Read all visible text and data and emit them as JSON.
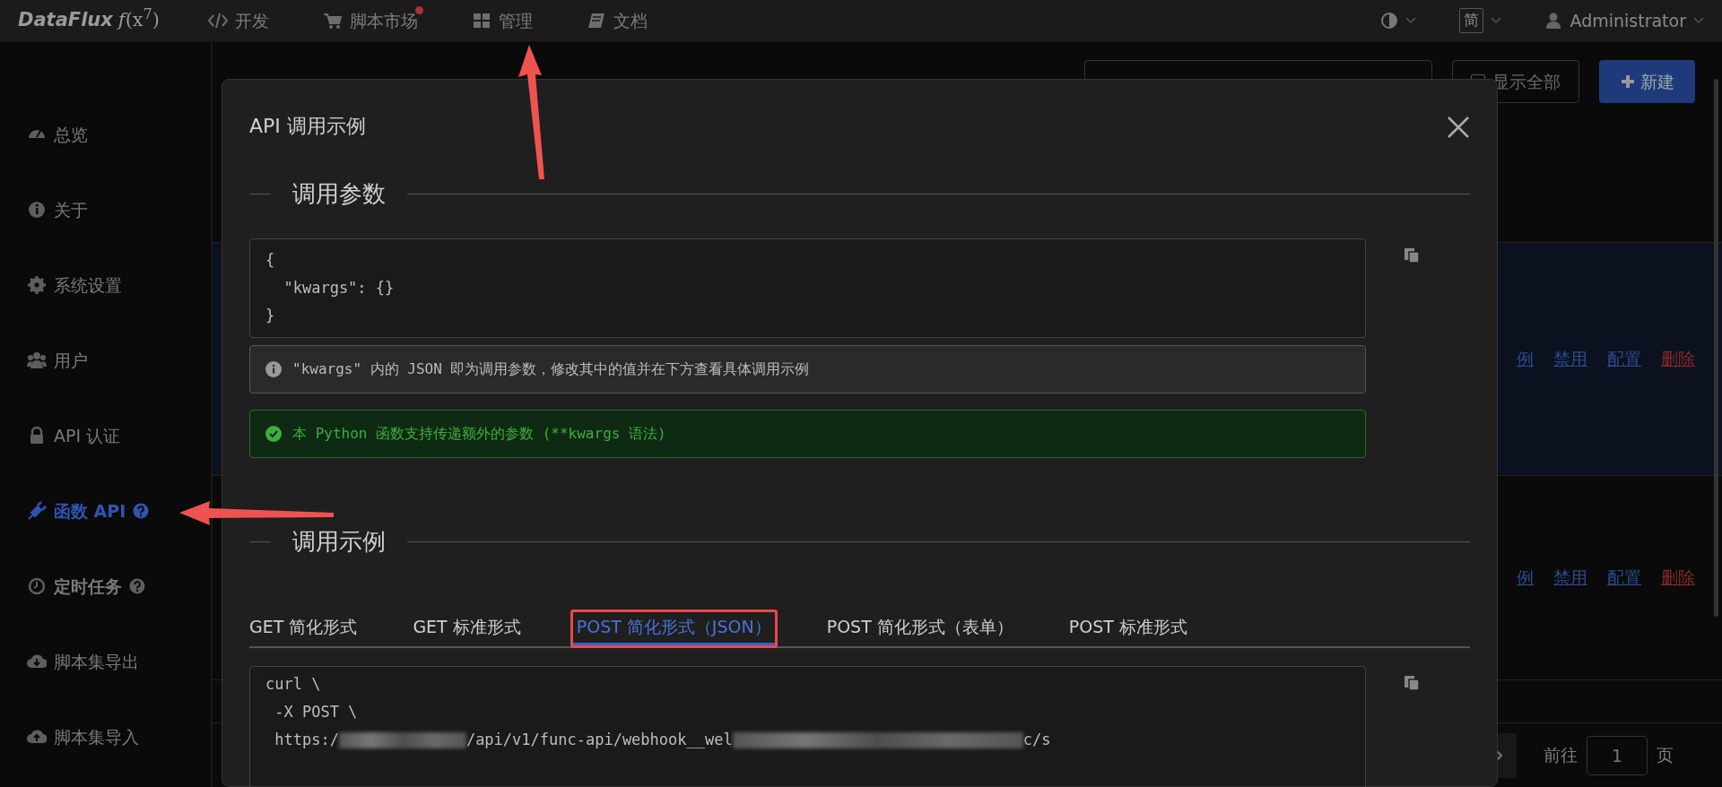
{
  "topbar": {
    "logo": "DataFlux",
    "logo_mark": "*f*(x$^{7}$)",
    "nav": [
      {
        "label": "开发",
        "kind": "code",
        "notification": false
      },
      {
        "label": "脚本市场",
        "kind": "cart",
        "notification": true
      },
      {
        "label": "管理",
        "kind": "grid",
        "notification": false
      },
      {
        "label": "文档",
        "kind": "book",
        "notification": false
      }
    ],
    "language": "简",
    "user": "Administrator"
  },
  "sidebar": {
    "items": [
      {
        "label": "总览",
        "kind": "gauge",
        "selected": false,
        "bold": false,
        "help": false
      },
      {
        "label": "关于",
        "kind": "info",
        "selected": false,
        "bold": false,
        "help": false
      },
      {
        "label": "系统设置",
        "kind": "gear",
        "selected": false,
        "bold": false,
        "help": false
      },
      {
        "label": "用户",
        "kind": "users",
        "selected": false,
        "bold": false,
        "help": false
      },
      {
        "label": "API 认证",
        "kind": "lock",
        "selected": false,
        "bold": false,
        "help": false
      },
      {
        "label": "函数 API",
        "kind": "plug",
        "selected": true,
        "bold": true,
        "help": true
      },
      {
        "label": "定时任务",
        "kind": "clock",
        "selected": false,
        "bold": true,
        "help": true
      },
      {
        "label": "脚本集导出",
        "kind": "cloud-down",
        "selected": false,
        "bold": false,
        "help": false
      },
      {
        "label": "脚本集导入",
        "kind": "cloud-up",
        "selected": false,
        "bold": false,
        "help": false
      }
    ]
  },
  "page": {
    "show_all": {
      "label": "显示全部",
      "checked": false
    },
    "new_button": "新建",
    "rows": [
      {
        "highlighted": true,
        "actions": [
          {
            "label": "例",
            "kind": "link"
          },
          {
            "label": "禁用",
            "kind": "link"
          },
          {
            "label": "配置",
            "kind": "link"
          },
          {
            "label": "删除",
            "kind": "danger"
          }
        ]
      },
      {
        "highlighted": false,
        "actions": [
          {
            "label": "例",
            "kind": "link"
          },
          {
            "label": "禁用",
            "kind": "link"
          },
          {
            "label": "配置",
            "kind": "link"
          },
          {
            "label": "删除",
            "kind": "danger"
          }
        ]
      }
    ],
    "pagination": {
      "goto": "前往",
      "page": "1",
      "suffix": "页"
    }
  },
  "dialog": {
    "title": "API 调用示例",
    "params": {
      "heading": "调用参数",
      "code": [
        "{",
        "  \"kwargs\": {}",
        "}"
      ],
      "info": "\"kwargs\" 内的 JSON 即为调用参数，修改其中的值并在下方查看具体调用示例",
      "success": "本 Python 函数支持传递额外的参数 (**kwargs 语法)"
    },
    "examples": {
      "heading": "调用示例",
      "tabs": [
        {
          "label": "GET 简化形式",
          "selected": false,
          "outlined": false
        },
        {
          "label": "GET 标准形式",
          "selected": false,
          "outlined": false
        },
        {
          "label": "POST 简化形式（JSON）",
          "selected": true,
          "outlined": true
        },
        {
          "label": "POST 简化形式（表单）",
          "selected": false,
          "outlined": false
        },
        {
          "label": "POST 标准形式",
          "selected": false,
          "outlined": false
        }
      ],
      "code": [
        [
          {
            "kind": "text",
            "text": "curl \\"
          }
        ],
        [
          {
            "kind": "text",
            "text": " -X POST \\"
          }
        ],
        [
          {
            "kind": "text",
            "text": " https:/"
          },
          {
            "kind": "redacted"
          },
          {
            "kind": "text",
            "text": "/api/v1/func-api/webhook__wel"
          },
          {
            "kind": "redacted"
          },
          {
            "kind": "text",
            "text": "c/s"
          }
        ]
      ]
    }
  }
}
